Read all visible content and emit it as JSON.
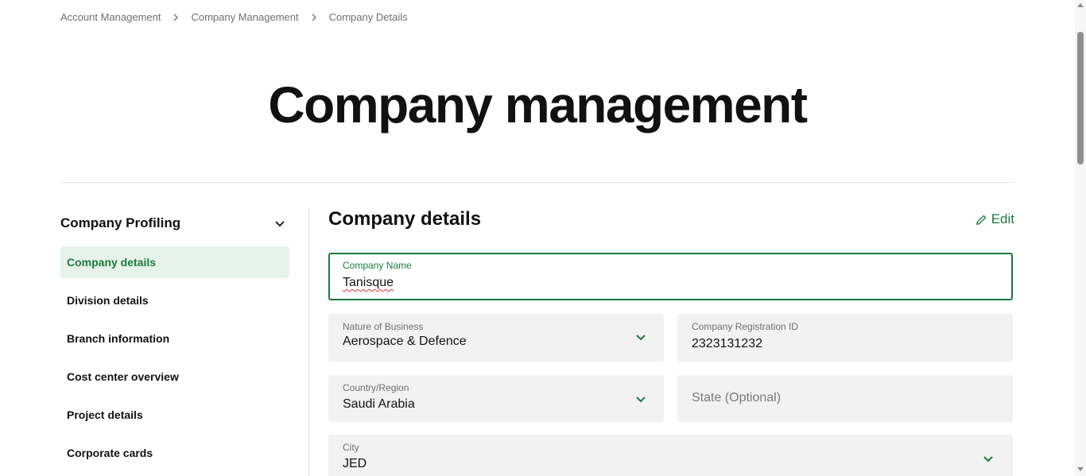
{
  "breadcrumb": {
    "items": [
      "Account Management",
      "Company Management",
      "Company Details"
    ]
  },
  "page": {
    "title": "Company management"
  },
  "sidebar": {
    "title": "Company Profiling",
    "items": [
      {
        "label": "Company details",
        "active": true
      },
      {
        "label": "Division details",
        "active": false
      },
      {
        "label": "Branch information",
        "active": false
      },
      {
        "label": "Cost center overview",
        "active": false
      },
      {
        "label": "Project details",
        "active": false
      },
      {
        "label": "Corporate cards",
        "active": false
      }
    ]
  },
  "main": {
    "section_title": "Company details",
    "edit_label": "Edit"
  },
  "form": {
    "company_name": {
      "label": "Company Name",
      "value": "Tanisque"
    },
    "nature_of_business": {
      "label": "Nature of Business",
      "value": "Aerospace & Defence"
    },
    "registration_id": {
      "label": "Company Registration ID",
      "value": "2323131232"
    },
    "country": {
      "label": "Country/Region",
      "value": "Saudi Arabia"
    },
    "state": {
      "placeholder": "State (Optional)"
    },
    "city": {
      "label": "City",
      "value": "JED"
    }
  },
  "colors": {
    "accent": "#1a7a3e",
    "active_bg": "#e6f2ea",
    "field_bg": "#f2f2f2"
  },
  "icons": [
    "chevron-right-icon",
    "chevron-down-icon",
    "pencil-icon"
  ]
}
